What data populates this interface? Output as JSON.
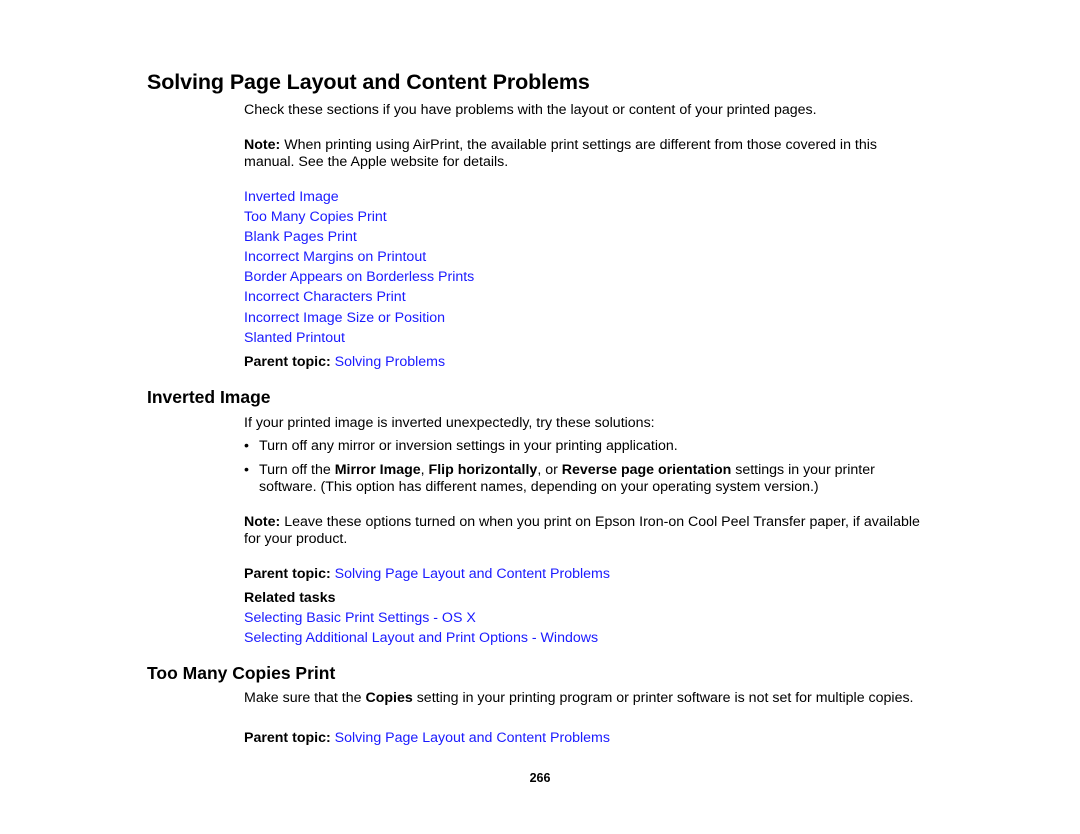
{
  "title": "Solving Page Layout and Content Problems",
  "intro": "Check these sections if you have problems with the layout or content of your printed pages.",
  "note1": {
    "label": "Note:",
    "text": " When printing using AirPrint, the available print settings are different from those covered in this manual. See the Apple website for details."
  },
  "links": [
    "Inverted Image",
    "Too Many Copies Print",
    "Blank Pages Print",
    "Incorrect Margins on Printout",
    "Border Appears on Borderless Prints",
    "Incorrect Characters Print",
    "Incorrect Image Size or Position",
    "Slanted Printout"
  ],
  "parent_topic_1": {
    "label": "Parent topic:",
    "link": "Solving Problems"
  },
  "inverted": {
    "heading": "Inverted Image",
    "intro": "If your printed image is inverted unexpectedly, try these solutions:",
    "bullet_char": "•",
    "bullet1": "Turn off any mirror or inversion settings in your printing application.",
    "bullet2": {
      "t1": "Turn off the ",
      "b1": "Mirror Image",
      "t2": ", ",
      "b2": "Flip horizontally",
      "t3": ", or ",
      "b3": "Reverse page orientation",
      "t4": " settings in your printer software. (This option has different names, depending on your operating system version.)"
    },
    "note": {
      "label": "Note:",
      "text": " Leave these options turned on when you print on Epson Iron-on Cool Peel Transfer paper, if available for your product."
    },
    "parent_topic": {
      "label": "Parent topic:",
      "link": "Solving Page Layout and Content Problems"
    },
    "related_tasks_label": "Related tasks",
    "related_tasks": [
      "Selecting Basic Print Settings - OS X",
      "Selecting Additional Layout and Print Options - Windows"
    ]
  },
  "too_many": {
    "heading": "Too Many Copies Print",
    "t1": "Make sure that the ",
    "b1": "Copies",
    "t2": " setting in your printing program or printer software is not set for multiple copies.",
    "parent_topic": {
      "label": "Parent topic:",
      "link": "Solving Page Layout and Content Problems"
    }
  },
  "page_number": "266",
  "colors": {
    "link": "#1a1aff",
    "text": "#000000",
    "background": "#ffffff"
  }
}
